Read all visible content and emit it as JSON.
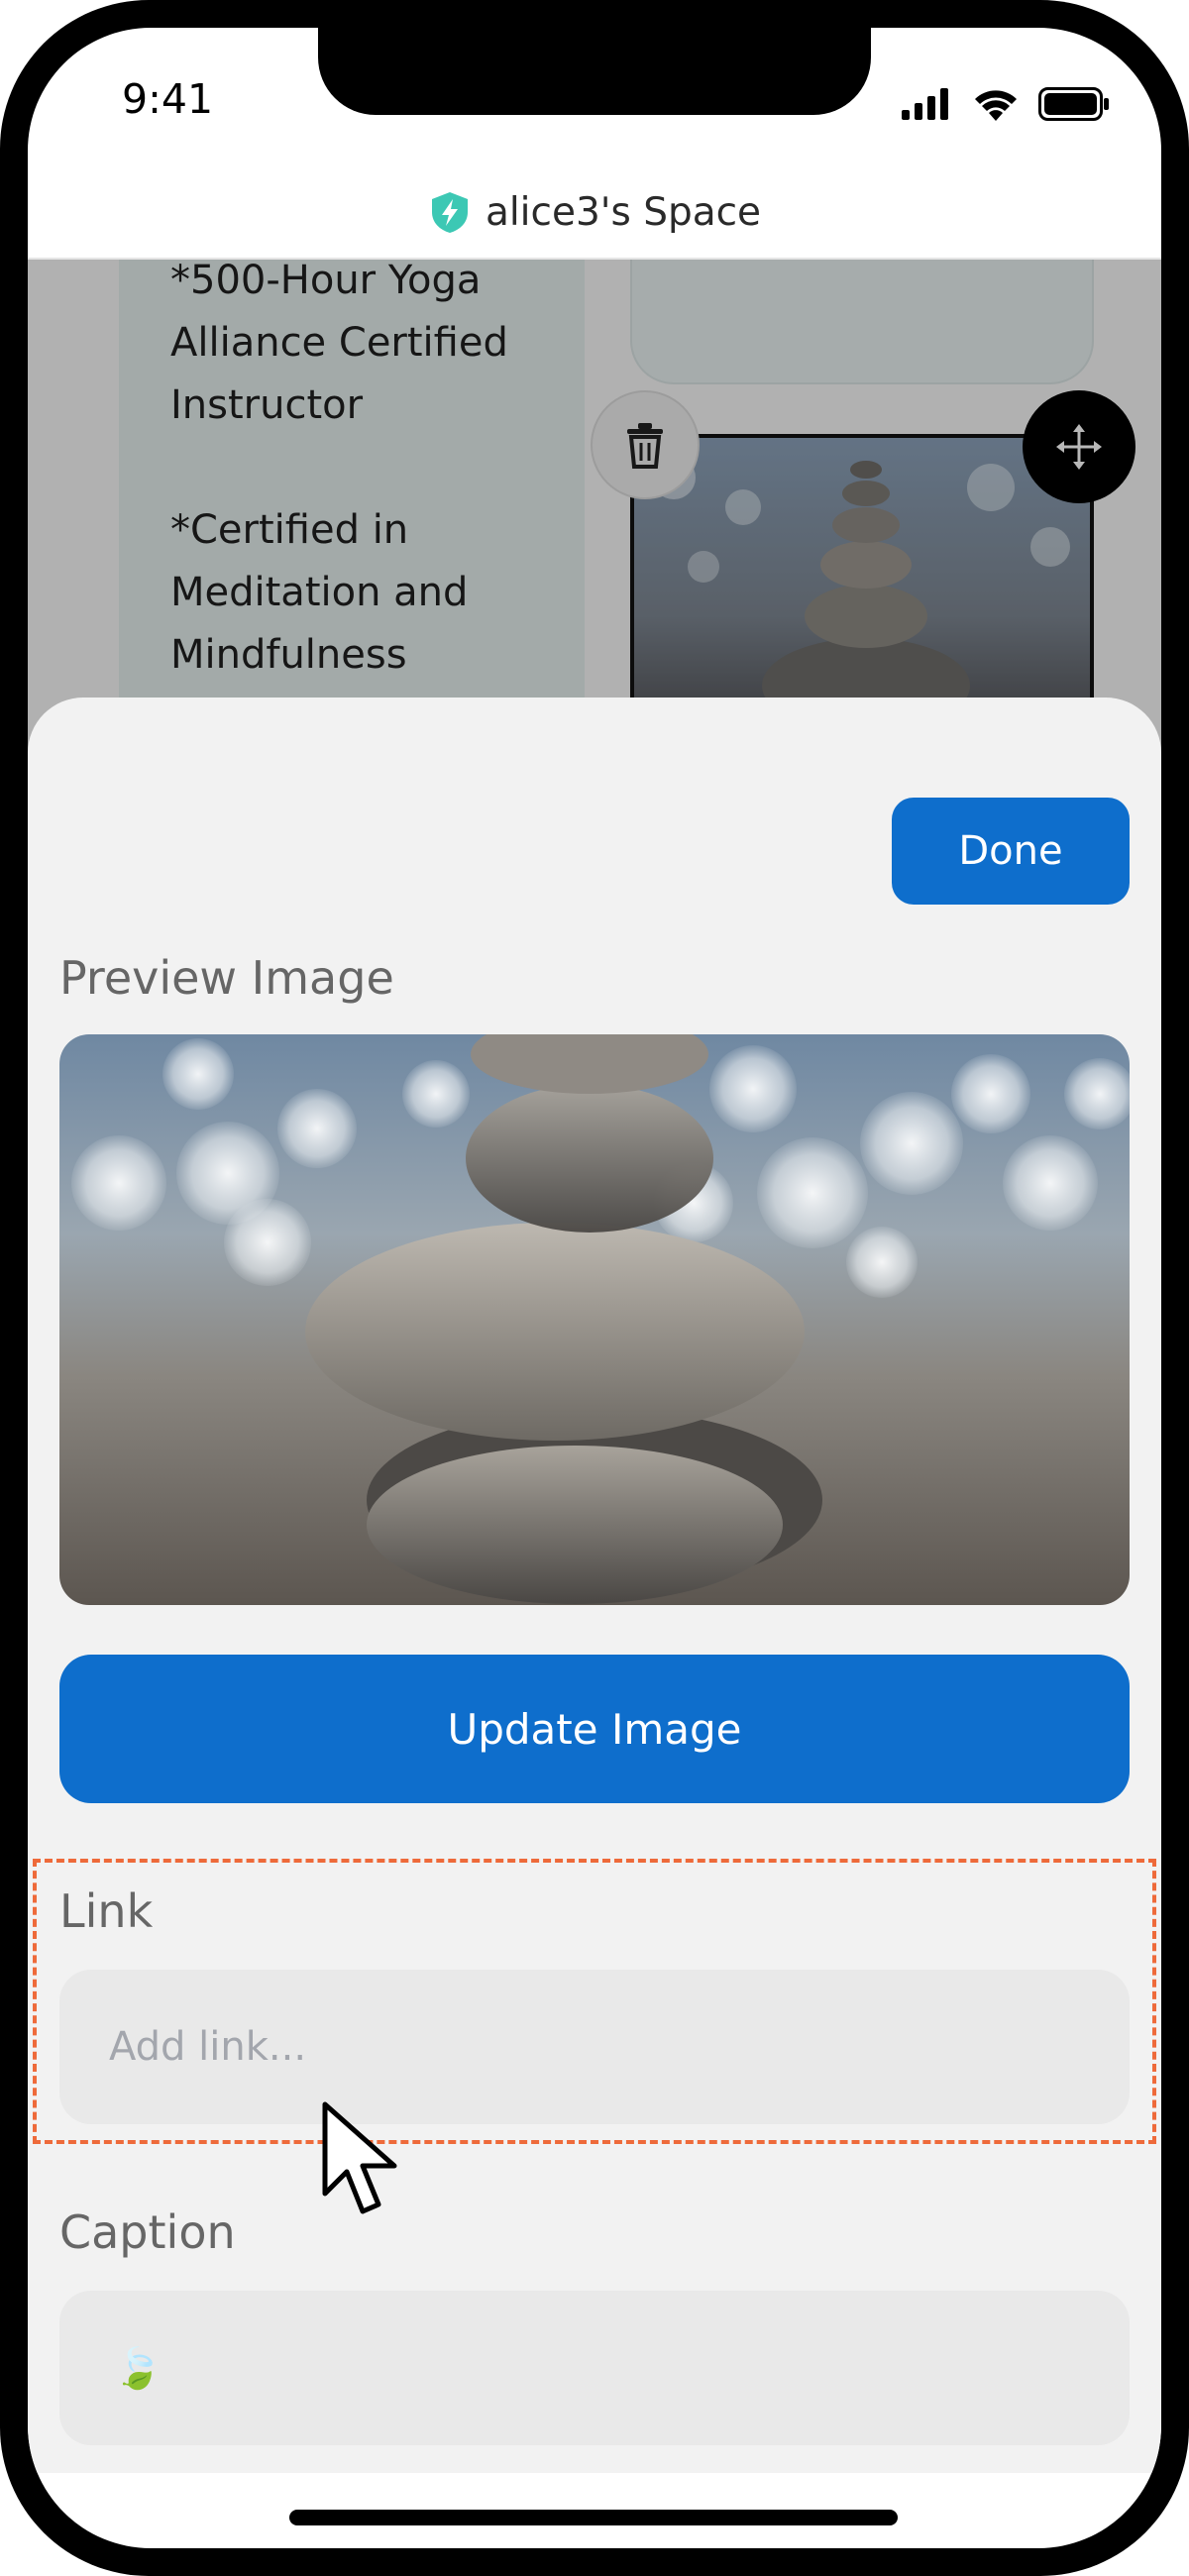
{
  "status_bar": {
    "time": "9:41"
  },
  "header": {
    "title": "alice3's Space",
    "accent_color": "#3cc8b4"
  },
  "background": {
    "text_card_lines": "*500-Hour Yoga\nAlliance Certified\nInstructor\n\n*Certified in\nMeditation and\nMindfulness\nCoaching"
  },
  "sheet": {
    "done_label": "Done",
    "preview_label": "Preview Image",
    "update_image_label": "Update Image",
    "link_label": "Link",
    "link_placeholder": "Add link...",
    "link_value": "",
    "caption_label": "Caption",
    "caption_value": "🍃"
  },
  "colors": {
    "primary": "#0e6ecc",
    "highlight": "#ee6a3a"
  },
  "icons": [
    "shield-bolt-icon",
    "trash-icon",
    "move-icon",
    "signal-icon",
    "wifi-icon",
    "battery-icon",
    "cursor-icon"
  ]
}
